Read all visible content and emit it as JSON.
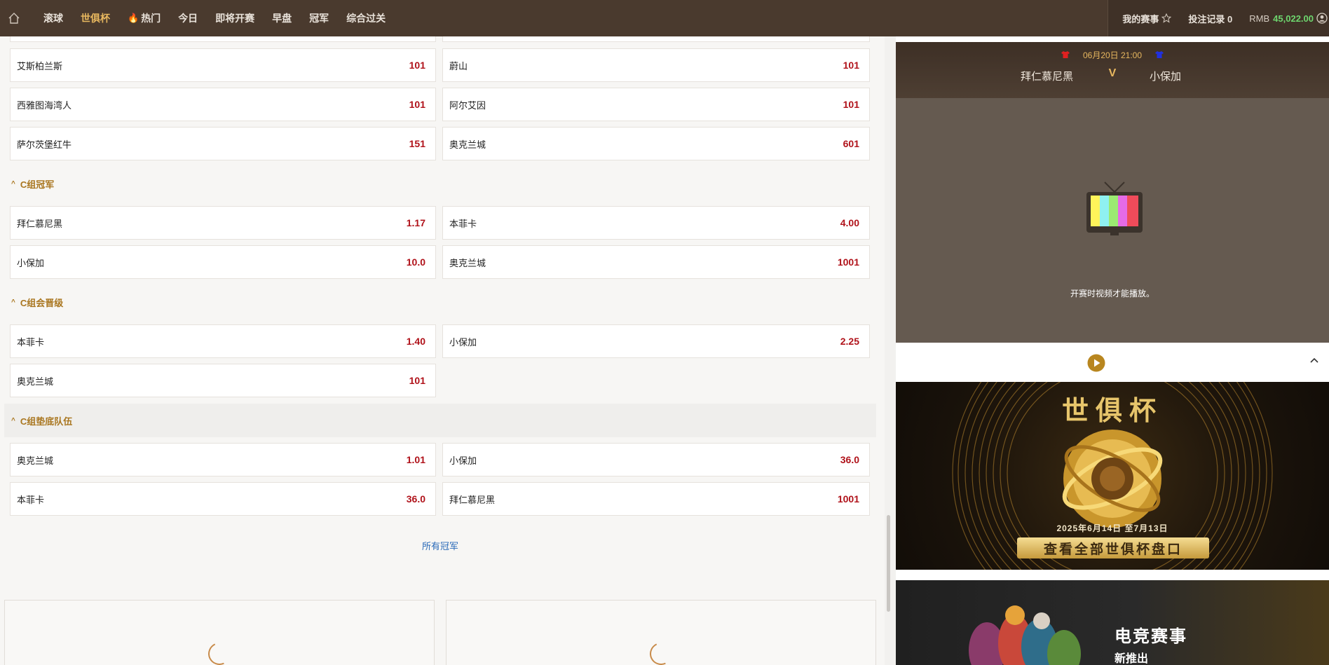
{
  "topbar": {
    "nav": [
      {
        "label": "滚球",
        "active": false
      },
      {
        "label": "世俱杯",
        "active": true
      },
      {
        "label": "热门",
        "active": false,
        "icon": "flame-icon"
      },
      {
        "label": "今日",
        "active": false
      },
      {
        "label": "即将开赛",
        "active": false
      },
      {
        "label": "早盘",
        "active": false
      },
      {
        "label": "冠军",
        "active": false
      },
      {
        "label": "综合过关",
        "active": false
      }
    ],
    "my_events": "我的赛事",
    "bet_records": "投注记录 0",
    "currency": "RMB",
    "balance": "45,022.00"
  },
  "left": {
    "top_rows": [
      {
        "left": {
          "name": "艾斯柏兰斯",
          "odds": "101"
        },
        "right": {
          "name": "蔚山",
          "odds": "101"
        }
      },
      {
        "left": {
          "name": "西雅图海湾人",
          "odds": "101"
        },
        "right": {
          "name": "阿尔艾因",
          "odds": "101"
        }
      },
      {
        "left": {
          "name": "萨尔茨堡红牛",
          "odds": "151"
        },
        "right": {
          "name": "奥克兰城",
          "odds": "601"
        }
      }
    ],
    "sections": [
      {
        "title": "C组冠军",
        "rows": [
          {
            "left": {
              "name": "拜仁慕尼黑",
              "odds": "1.17"
            },
            "right": {
              "name": "本菲卡",
              "odds": "4.00"
            }
          },
          {
            "left": {
              "name": "小保加",
              "odds": "10.0"
            },
            "right": {
              "name": "奥克兰城",
              "odds": "1001"
            }
          }
        ]
      },
      {
        "title": "C组会晋级",
        "rows": [
          {
            "left": {
              "name": "本菲卡",
              "odds": "1.40"
            },
            "right": {
              "name": "小保加",
              "odds": "2.25"
            }
          },
          {
            "left": {
              "name": "奥克兰城",
              "odds": "101"
            }
          }
        ]
      },
      {
        "title": "C组垫底队伍",
        "rows": [
          {
            "left": {
              "name": "奥克兰城",
              "odds": "1.01"
            },
            "right": {
              "name": "小保加",
              "odds": "36.0"
            }
          },
          {
            "left": {
              "name": "本菲卡",
              "odds": "36.0"
            },
            "right": {
              "name": "拜仁慕尼黑",
              "odds": "1001"
            }
          }
        ]
      }
    ],
    "all_link": "所有冠军"
  },
  "right": {
    "match": {
      "time": "06月20日 21:00",
      "home": "拜仁慕尼黑",
      "vs": "V",
      "away": "小保加",
      "home_color": "#e02020",
      "away_color": "#2030e0"
    },
    "video_message": "开赛时视频才能播放。",
    "banner_worldcup": {
      "title": "世俱杯",
      "dates": "2025年6月14日 至7月13日",
      "cta": "查看全部世俱杯盘口"
    },
    "banner_esports": {
      "title": "电竞赛事",
      "subtitle": "新推出"
    }
  },
  "colors": {
    "topbar_bg": "#4a3a2e",
    "accent_gold": "#e8b85f",
    "odds_red": "#b0121a",
    "section_title": "#a9761f",
    "balance_green": "#6ed66e"
  }
}
